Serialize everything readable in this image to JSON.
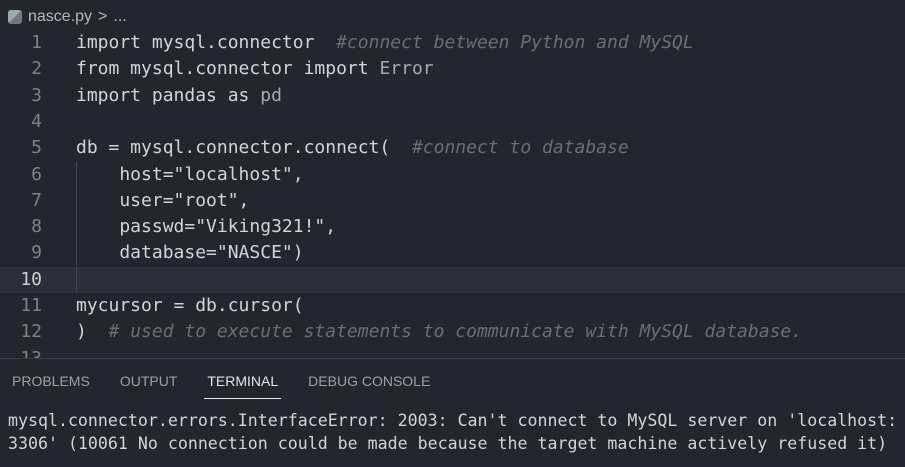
{
  "breadcrumb": {
    "file": "nasce.py",
    "sep": ">",
    "rest": "..."
  },
  "editor": {
    "lines": [
      {
        "n": "1",
        "code": "import mysql.connector  ",
        "comment": "#connect between Python and MySQL"
      },
      {
        "n": "2",
        "code": "from mysql.connector import ",
        "dim": "Error"
      },
      {
        "n": "3",
        "code": "import pandas as ",
        "dim": "pd"
      },
      {
        "n": "4",
        "code": ""
      },
      {
        "n": "5",
        "code": "db = mysql.connector.connect(  ",
        "comment": "#connect to database"
      },
      {
        "n": "6",
        "code": "    host=\"localhost\","
      },
      {
        "n": "7",
        "code": "    user=\"root\","
      },
      {
        "n": "8",
        "code": "    passwd=\"Viking321!\","
      },
      {
        "n": "9",
        "code": "    database=\"NASCE\")"
      },
      {
        "n": "10",
        "code": ""
      },
      {
        "n": "11",
        "code": "mycursor = db.cursor("
      },
      {
        "n": "12",
        "code": ")  ",
        "comment": "# used to execute statements to communicate with MySQL database."
      },
      {
        "n": "13",
        "code": ""
      }
    ]
  },
  "panel": {
    "tabs": [
      "PROBLEMS",
      "OUTPUT",
      "TERMINAL",
      "DEBUG CONSOLE"
    ],
    "active": "TERMINAL"
  },
  "terminal": {
    "lines": [
      "mysql.connector.errors.InterfaceError: 2003: Can't connect to MySQL server on 'localhost:",
      "3306' (10061 No connection could be made because the target machine actively refused it)"
    ]
  }
}
